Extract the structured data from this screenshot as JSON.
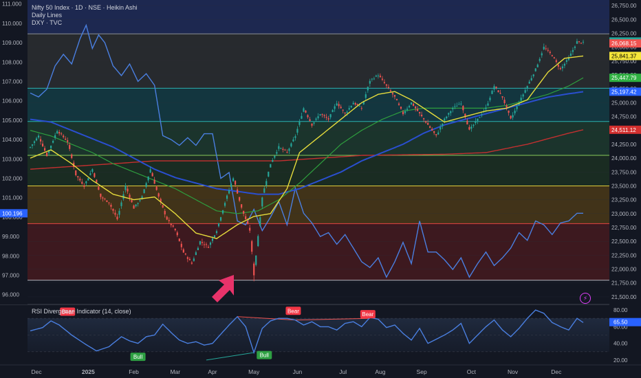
{
  "legend": {
    "symbol": "Nifty 50 Index · 1D · NSE · Heikin Ashi",
    "overlay1": "Daily Lines",
    "overlay2": "DXY · TVC"
  },
  "rsi_legend": "RSI Divergence Indicator (14, close)",
  "bolt_icon": "lightning-icon",
  "colors": {
    "background": "#131722",
    "up": "#26a69a",
    "down": "#ef5350",
    "dxy": "#4a7fe0",
    "ma_yellow": "#e6dc3c",
    "ma_green": "#2e9e3e",
    "ma_blue": "#2a4fd0",
    "ma_red": "#c43030",
    "arrow": "#e8336a"
  },
  "chart_data": [
    {
      "type": "candlestick",
      "title": "Nifty 50 Index · 1D · NSE · Heikin Ashi",
      "x_ticks": [
        "Dec",
        "2025",
        "Feb",
        "Mar",
        "Apr",
        "May",
        "Jun",
        "Jul",
        "Aug",
        "Sep",
        "Oct",
        "Nov",
        "Dec"
      ],
      "right_axis": {
        "ticks": [
          "26,750.00",
          "26,500.00",
          "26,250.00",
          "26,000.00",
          "25,750.00",
          "25,500.00",
          "25,250.00",
          "25,000.00",
          "24,750.00",
          "24,500.00",
          "24,250.00",
          "24,000.00",
          "23,750.00",
          "23,500.00",
          "23,250.00",
          "23,000.00",
          "22,750.00",
          "22,500.00",
          "22,250.00",
          "22,000.00",
          "21,750.00",
          "21,500.00"
        ],
        "range": [
          21400,
          26850
        ]
      },
      "left_axis": {
        "ticks": [
          "111.000",
          "110.000",
          "109.000",
          "108.000",
          "107.000",
          "106.000",
          "105.000",
          "104.000",
          "103.000",
          "102.000",
          "101.000",
          "100.000",
          "99.000",
          "98.000",
          "97.000",
          "96.000"
        ],
        "range": [
          95.6,
          111.2
        ]
      },
      "price_labels": [
        {
          "text": "26,102.30",
          "color": "#26a69a"
        },
        {
          "text": "26,068.15",
          "color": "#ef5350"
        },
        {
          "text": "25,841.37",
          "color": "#f5e63a"
        },
        {
          "text": "25,447.79",
          "color": "#2fb042"
        },
        {
          "text": "25,197.42",
          "color": "#2962ff"
        },
        {
          "text": "24,511.12",
          "color": "#d32f2f"
        }
      ],
      "dxy_label": "100.196",
      "horizontal_levels": [
        26240,
        25260,
        24660,
        24050,
        23500,
        22820,
        21800
      ],
      "nifty_anchors": [
        [
          0,
          24200
        ],
        [
          4,
          24400
        ],
        [
          8,
          24050
        ],
        [
          13,
          24500
        ],
        [
          18,
          24300
        ],
        [
          22,
          23700
        ],
        [
          26,
          23500
        ],
        [
          30,
          23800
        ],
        [
          34,
          23300
        ],
        [
          38,
          23200
        ],
        [
          42,
          22900
        ],
        [
          46,
          23500
        ],
        [
          50,
          23100
        ],
        [
          54,
          23300
        ],
        [
          58,
          23800
        ],
        [
          62,
          23300
        ],
        [
          66,
          22900
        ],
        [
          70,
          22700
        ],
        [
          74,
          22300
        ],
        [
          78,
          22100
        ],
        [
          82,
          22500
        ],
        [
          86,
          22400
        ],
        [
          90,
          22700
        ],
        [
          94,
          23200
        ],
        [
          98,
          23650
        ],
        [
          102,
          23100
        ],
        [
          106,
          22700
        ],
        [
          108,
          21900
        ],
        [
          112,
          23300
        ],
        [
          116,
          23900
        ],
        [
          120,
          24200
        ],
        [
          124,
          24100
        ],
        [
          128,
          24400
        ],
        [
          132,
          24900
        ],
        [
          136,
          24600
        ],
        [
          140,
          24800
        ],
        [
          144,
          24700
        ],
        [
          148,
          25000
        ],
        [
          152,
          24800
        ],
        [
          156,
          25000
        ],
        [
          160,
          24900
        ],
        [
          164,
          25400
        ],
        [
          168,
          25500
        ],
        [
          172,
          25300
        ],
        [
          176,
          25100
        ],
        [
          180,
          24800
        ],
        [
          184,
          25000
        ],
        [
          188,
          24800
        ],
        [
          192,
          24600
        ],
        [
          196,
          24400
        ],
        [
          200,
          24700
        ],
        [
          204,
          24900
        ],
        [
          208,
          25000
        ],
        [
          212,
          24500
        ],
        [
          216,
          24700
        ],
        [
          220,
          24900
        ],
        [
          224,
          25300
        ],
        [
          228,
          25100
        ],
        [
          232,
          24700
        ],
        [
          236,
          25000
        ],
        [
          240,
          25300
        ],
        [
          244,
          25600
        ],
        [
          248,
          26000
        ],
        [
          252,
          25850
        ],
        [
          256,
          25600
        ],
        [
          260,
          25800
        ],
        [
          264,
          26100
        ],
        [
          267,
          26080
        ]
      ],
      "dxy_anchors": [
        [
          0,
          106.4
        ],
        [
          4,
          106.2
        ],
        [
          8,
          106.6
        ],
        [
          12,
          107.8
        ],
        [
          16,
          108.4
        ],
        [
          20,
          107.9
        ],
        [
          24,
          109.2
        ],
        [
          27,
          109.9
        ],
        [
          30,
          108.7
        ],
        [
          33,
          109.4
        ],
        [
          36,
          109.0
        ],
        [
          40,
          107.8
        ],
        [
          44,
          107.3
        ],
        [
          48,
          107.9
        ],
        [
          52,
          107.0
        ],
        [
          56,
          107.4
        ],
        [
          60,
          106.8
        ],
        [
          64,
          104.2
        ],
        [
          68,
          104.0
        ],
        [
          72,
          103.7
        ],
        [
          76,
          104.1
        ],
        [
          80,
          103.7
        ],
        [
          84,
          104.3
        ],
        [
          88,
          104.3
        ],
        [
          92,
          102.0
        ],
        [
          96,
          102.3
        ],
        [
          100,
          99.8
        ],
        [
          104,
          99.6
        ],
        [
          108,
          100.4
        ],
        [
          112,
          99.3
        ],
        [
          116,
          100.0
        ],
        [
          120,
          100.8
        ],
        [
          124,
          99.6
        ],
        [
          128,
          101.5
        ],
        [
          132,
          100.2
        ],
        [
          136,
          99.7
        ],
        [
          140,
          99.0
        ],
        [
          144,
          99.2
        ],
        [
          148,
          98.6
        ],
        [
          152,
          99.1
        ],
        [
          156,
          98.4
        ],
        [
          160,
          97.7
        ],
        [
          164,
          97.4
        ],
        [
          168,
          97.9
        ],
        [
          172,
          96.9
        ],
        [
          176,
          97.7
        ],
        [
          180,
          98.7
        ],
        [
          184,
          97.6
        ],
        [
          188,
          99.8
        ],
        [
          192,
          98.2
        ],
        [
          196,
          98.2
        ],
        [
          200,
          97.8
        ],
        [
          204,
          97.3
        ],
        [
          208,
          97.9
        ],
        [
          212,
          96.9
        ],
        [
          216,
          97.6
        ],
        [
          220,
          98.2
        ],
        [
          224,
          97.5
        ],
        [
          228,
          97.9
        ],
        [
          232,
          98.4
        ],
        [
          236,
          99.2
        ],
        [
          240,
          98.8
        ],
        [
          244,
          99.8
        ],
        [
          248,
          99.6
        ],
        [
          252,
          99.1
        ],
        [
          256,
          99.7
        ],
        [
          260,
          99.8
        ],
        [
          264,
          100.2
        ],
        [
          267,
          100.2
        ]
      ],
      "ma_yellow": [
        [
          0,
          24000
        ],
        [
          10,
          24150
        ],
        [
          20,
          23900
        ],
        [
          30,
          23600
        ],
        [
          40,
          23350
        ],
        [
          50,
          23250
        ],
        [
          60,
          23300
        ],
        [
          70,
          23000
        ],
        [
          80,
          22650
        ],
        [
          90,
          22550
        ],
        [
          100,
          22800
        ],
        [
          108,
          22950
        ],
        [
          116,
          23000
        ],
        [
          124,
          23450
        ],
        [
          130,
          24100
        ],
        [
          140,
          24400
        ],
        [
          150,
          24700
        ],
        [
          160,
          25000
        ],
        [
          168,
          25150
        ],
        [
          176,
          25200
        ],
        [
          184,
          25050
        ],
        [
          192,
          24850
        ],
        [
          200,
          24650
        ],
        [
          210,
          24750
        ],
        [
          220,
          24850
        ],
        [
          230,
          24900
        ],
        [
          240,
          25050
        ],
        [
          250,
          25550
        ],
        [
          258,
          25800
        ],
        [
          267,
          25841
        ]
      ],
      "ma_green": [
        [
          0,
          24500
        ],
        [
          10,
          24400
        ],
        [
          20,
          24250
        ],
        [
          30,
          24100
        ],
        [
          40,
          23900
        ],
        [
          50,
          23750
        ],
        [
          60,
          23600
        ],
        [
          70,
          23450
        ],
        [
          80,
          23250
        ],
        [
          90,
          23050
        ],
        [
          100,
          23000
        ],
        [
          110,
          23050
        ],
        [
          120,
          23250
        ],
        [
          130,
          23550
        ],
        [
          140,
          23900
        ],
        [
          150,
          24250
        ],
        [
          160,
          24500
        ],
        [
          170,
          24700
        ],
        [
          180,
          24850
        ],
        [
          190,
          24900
        ],
        [
          200,
          24900
        ],
        [
          210,
          24900
        ],
        [
          220,
          24900
        ],
        [
          230,
          24950
        ],
        [
          240,
          25050
        ],
        [
          250,
          25150
        ],
        [
          260,
          25300
        ],
        [
          267,
          25448
        ]
      ],
      "ma_blue": [
        [
          0,
          24700
        ],
        [
          10,
          24650
        ],
        [
          20,
          24500
        ],
        [
          30,
          24350
        ],
        [
          40,
          24200
        ],
        [
          50,
          24000
        ],
        [
          60,
          23800
        ],
        [
          70,
          23650
        ],
        [
          80,
          23550
        ],
        [
          90,
          23450
        ],
        [
          100,
          23400
        ],
        [
          110,
          23350
        ],
        [
          120,
          23350
        ],
        [
          130,
          23450
        ],
        [
          140,
          23600
        ],
        [
          150,
          23750
        ],
        [
          160,
          23950
        ],
        [
          170,
          24100
        ],
        [
          180,
          24250
        ],
        [
          190,
          24450
        ],
        [
          200,
          24600
        ],
        [
          210,
          24700
        ],
        [
          220,
          24800
        ],
        [
          230,
          24900
        ],
        [
          240,
          25000
        ],
        [
          250,
          25100
        ],
        [
          260,
          25160
        ],
        [
          267,
          25197
        ]
      ],
      "ma_red": [
        [
          0,
          23800
        ],
        [
          20,
          23850
        ],
        [
          40,
          23900
        ],
        [
          60,
          23950
        ],
        [
          80,
          23950
        ],
        [
          100,
          23950
        ],
        [
          120,
          23950
        ],
        [
          140,
          24000
        ],
        [
          160,
          24050
        ],
        [
          180,
          24060
        ],
        [
          200,
          24070
        ],
        [
          220,
          24100
        ],
        [
          240,
          24250
        ],
        [
          260,
          24450
        ],
        [
          267,
          24511
        ]
      ]
    },
    {
      "type": "line",
      "title": "RSI Divergence Indicator (14, close)",
      "y_ticks": [
        "80.00",
        "60.00",
        "40.00",
        "20.00"
      ],
      "ylim": [
        15,
        85
      ],
      "current_value": "65.50",
      "rsi_anchors": [
        [
          0,
          55
        ],
        [
          6,
          59
        ],
        [
          10,
          67
        ],
        [
          14,
          62
        ],
        [
          20,
          50
        ],
        [
          26,
          40
        ],
        [
          32,
          31
        ],
        [
          38,
          36
        ],
        [
          44,
          48
        ],
        [
          48,
          43
        ],
        [
          52,
          40
        ],
        [
          56,
          48
        ],
        [
          60,
          50
        ],
        [
          64,
          63
        ],
        [
          68,
          53
        ],
        [
          72,
          44
        ],
        [
          76,
          40
        ],
        [
          80,
          42
        ],
        [
          84,
          38
        ],
        [
          88,
          40
        ],
        [
          92,
          51
        ],
        [
          96,
          62
        ],
        [
          100,
          72
        ],
        [
          104,
          60
        ],
        [
          108,
          29
        ],
        [
          112,
          58
        ],
        [
          116,
          67
        ],
        [
          120,
          70
        ],
        [
          124,
          70
        ],
        [
          128,
          68
        ],
        [
          132,
          62
        ],
        [
          136,
          66
        ],
        [
          140,
          60
        ],
        [
          144,
          60
        ],
        [
          148,
          56
        ],
        [
          152,
          64
        ],
        [
          156,
          66
        ],
        [
          160,
          60
        ],
        [
          164,
          71
        ],
        [
          168,
          69
        ],
        [
          172,
          59
        ],
        [
          176,
          62
        ],
        [
          180,
          52
        ],
        [
          184,
          44
        ],
        [
          188,
          58
        ],
        [
          192,
          40
        ],
        [
          196,
          45
        ],
        [
          200,
          50
        ],
        [
          204,
          56
        ],
        [
          208,
          64
        ],
        [
          212,
          40
        ],
        [
          216,
          50
        ],
        [
          220,
          60
        ],
        [
          224,
          68
        ],
        [
          228,
          56
        ],
        [
          232,
          48
        ],
        [
          236,
          58
        ],
        [
          240,
          70
        ],
        [
          244,
          80
        ],
        [
          248,
          76
        ],
        [
          252,
          65
        ],
        [
          256,
          60
        ],
        [
          260,
          56
        ],
        [
          264,
          70
        ],
        [
          267,
          65
        ]
      ],
      "labels": [
        {
          "text": "Bear",
          "kind": "bear"
        },
        {
          "text": "Bull",
          "kind": "bull"
        },
        {
          "text": "Bull",
          "kind": "bull"
        },
        {
          "text": "Bear",
          "kind": "bear"
        },
        {
          "text": "Bear",
          "kind": "bear"
        }
      ]
    }
  ]
}
